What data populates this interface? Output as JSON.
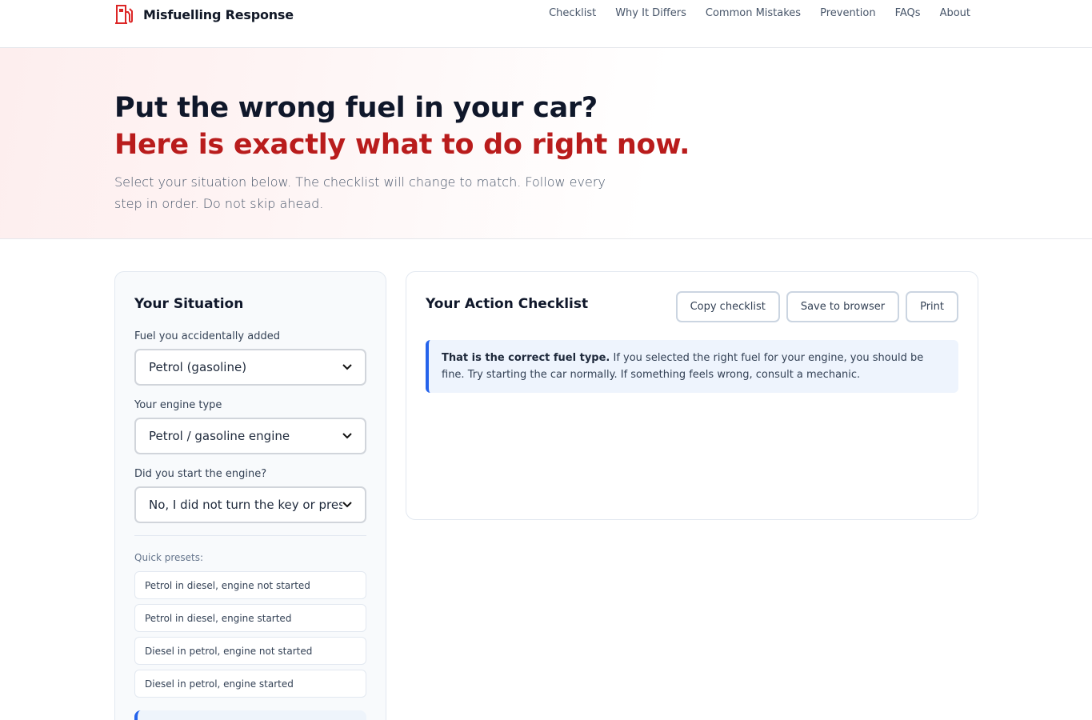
{
  "header": {
    "brand": "Misfuelling Response",
    "nav": [
      "Checklist",
      "Why It Differs",
      "Common Mistakes",
      "Prevention",
      "FAQs",
      "About"
    ]
  },
  "hero": {
    "title_line1": "Put the wrong fuel in your car?",
    "title_line2": "Here is exactly what to do right now.",
    "subtitle": "Select your situation below. The checklist will change to match. Follow every step in order. Do not skip ahead."
  },
  "situation": {
    "title": "Your Situation",
    "fuel_label": "Fuel you accidentally added",
    "fuel_value": "Petrol (gasoline)",
    "engine_label": "Your engine type",
    "engine_value": "Petrol / gasoline engine",
    "started_label": "Did you start the engine?",
    "started_value": "No, I did not turn the key or press st",
    "presets_label": "Quick presets:",
    "presets": [
      "Petrol in diesel, engine not started",
      "Petrol in diesel, engine started",
      "Diesel in petrol, engine not started",
      "Diesel in petrol, engine started"
    ]
  },
  "checklist": {
    "title": "Your Action Checklist",
    "buttons": {
      "copy": "Copy checklist",
      "save": "Save to browser",
      "print": "Print"
    },
    "info_bold": "That is the correct fuel type.",
    "info_text": " If you selected the right fuel for your engine, you should be fine. Try starting the car normally. If something feels wrong, consult a mechanic."
  },
  "colors": {
    "accent_red": "#b91c1c",
    "info_blue": "#2563eb"
  },
  "icons": {
    "brand": "fuel-pump-icon",
    "select": "chevron-down-icon"
  }
}
